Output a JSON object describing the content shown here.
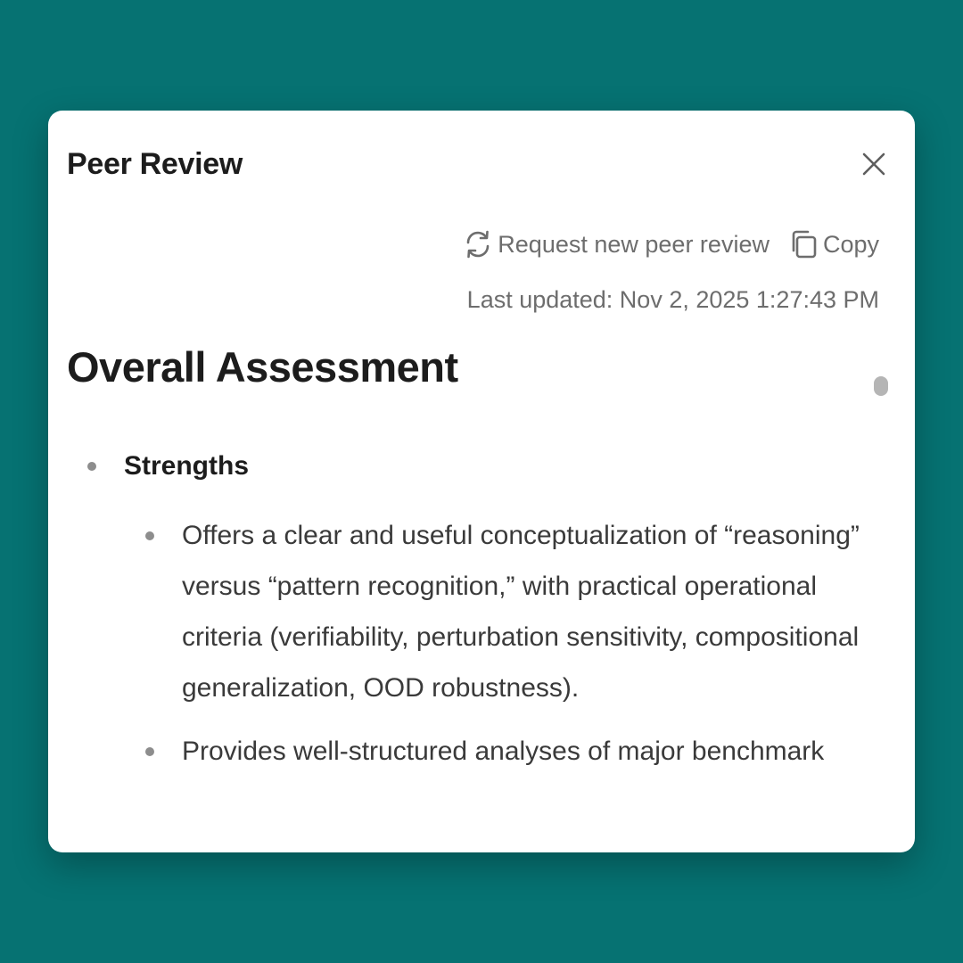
{
  "modal": {
    "title": "Peer Review",
    "actions": {
      "request_label": "Request new peer review",
      "copy_label": "Copy"
    },
    "last_updated": "Last updated: Nov 2, 2025 1:27:43 PM"
  },
  "content": {
    "heading": "Overall Assessment",
    "sections": [
      {
        "label": "Strengths",
        "items": [
          "Offers a clear and useful conceptualization of “reasoning” versus “pattern recognition,” with practical operational criteria (verifiability, perturbation sensitivity, compositional generalization, OOD robustness).",
          "Provides well-structured analyses of major benchmark"
        ]
      }
    ]
  },
  "colors": {
    "background": "#067272",
    "card": "#ffffff",
    "title_text": "#1c1c1c",
    "muted_text": "#6d6d6d",
    "bullet": "#8d8d8d"
  },
  "icons": {
    "close": "close-icon",
    "refresh": "refresh-icon",
    "copy": "copy-icon"
  }
}
